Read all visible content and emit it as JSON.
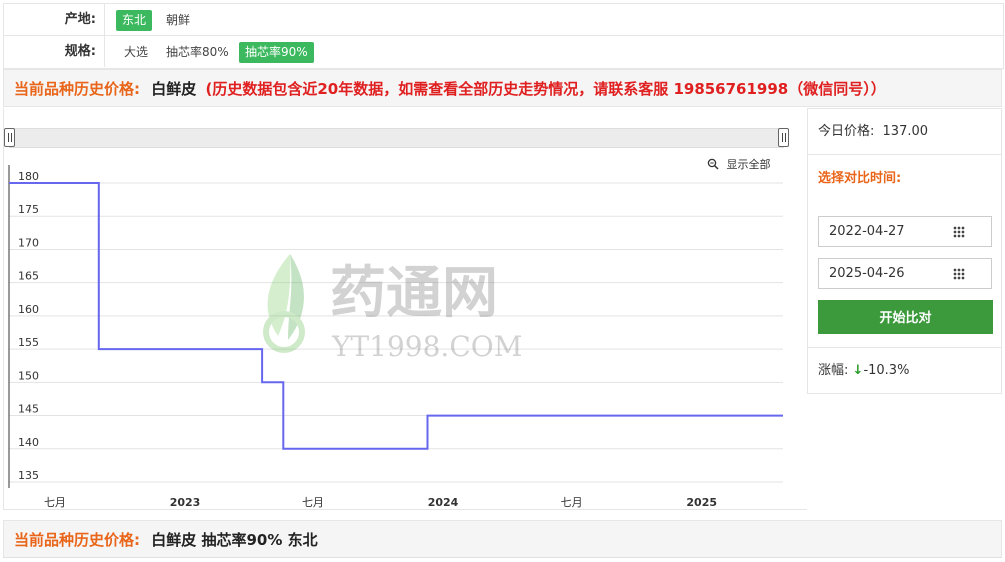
{
  "filters": {
    "origin": {
      "label": "产地:",
      "options": [
        {
          "label": "东北",
          "active": true
        },
        {
          "label": "朝鲜",
          "active": false
        }
      ]
    },
    "spec": {
      "label": "规格:",
      "options": [
        {
          "label": "大选",
          "active": false
        },
        {
          "label": "抽芯率80%",
          "active": false
        },
        {
          "label": "抽芯率90%",
          "active": true
        }
      ]
    }
  },
  "history_header": {
    "label": "当前品种历史价格:",
    "product": "白鲜皮",
    "notice": "(历史数据包含近20年数据，如需查看全部历史走势情况，请联系客服 19856761998（微信同号））"
  },
  "chart": {
    "zoom_label": "显示全部",
    "watermark_cn": "药通网",
    "watermark_en": "YT1998.COM"
  },
  "side": {
    "today_label": "今日价格:",
    "today_price": "137.00",
    "compare_title": "选择对比时间:",
    "start_date": "2022-04-27",
    "end_date": "2025-04-26",
    "compare_button": "开始比对",
    "change_label": "涨幅:",
    "change_arrow": "↓",
    "change_value": "-10.3%"
  },
  "bottom_header": {
    "label": "当前品种历史价格:",
    "product": "白鲜皮 抽芯率90% 东北"
  },
  "colors": {
    "accent_green": "#3cb95f",
    "button_green": "#3c9a3c",
    "orange": "#e9651a",
    "red": "#e02020",
    "line": "#6666ee"
  },
  "chart_data": {
    "type": "line",
    "series": [
      {
        "x": [
          "2022-04-27",
          "2022-09-01",
          "2022-09-01",
          "2023-04-20",
          "2023-04-20",
          "2023-05-20",
          "2023-05-20",
          "2023-12-10",
          "2023-12-10",
          "2025-04-26"
        ],
        "values": [
          180,
          180,
          155,
          155,
          150,
          150,
          140,
          140,
          145,
          145
        ]
      }
    ],
    "ylim": [
      135,
      180
    ],
    "yticks": [
      135,
      140,
      145,
      150,
      155,
      160,
      165,
      170,
      175,
      180
    ],
    "xlim": [
      "2022-04-27",
      "2025-04-26"
    ],
    "xticks": [
      {
        "label": "七月",
        "at": "2022-07-01",
        "bold": false
      },
      {
        "label": "2023",
        "at": "2023-01-01",
        "bold": true
      },
      {
        "label": "七月",
        "at": "2023-07-01",
        "bold": false
      },
      {
        "label": "2024",
        "at": "2024-01-01",
        "bold": true
      },
      {
        "label": "七月",
        "at": "2024-07-01",
        "bold": false
      },
      {
        "label": "2025",
        "at": "2025-01-01",
        "bold": true
      }
    ],
    "grid": true
  }
}
